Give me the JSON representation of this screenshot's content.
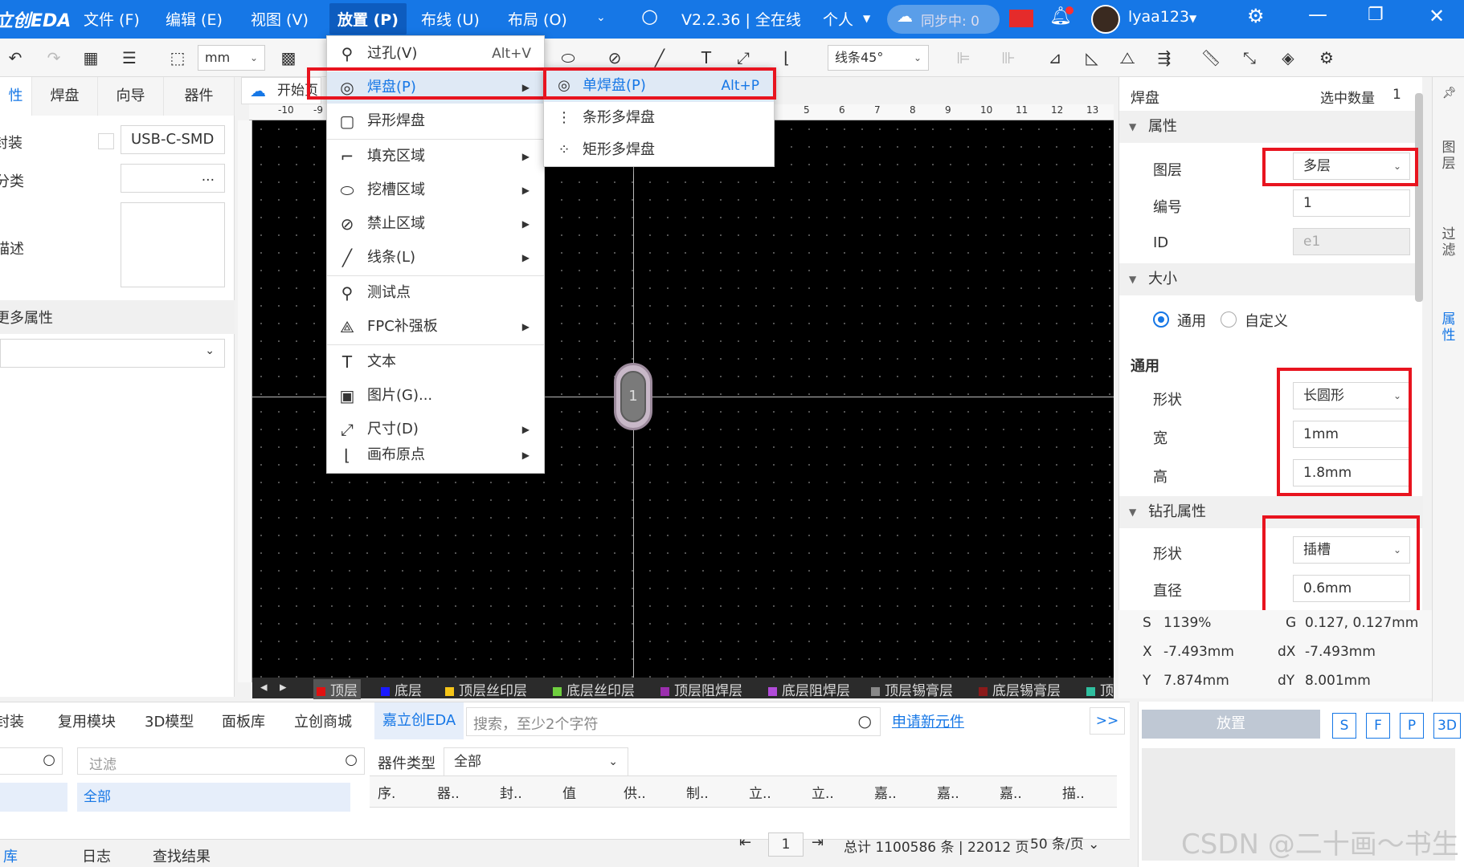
{
  "titlebar": {
    "logo": "立创EDA",
    "menus": [
      "文件 (F)",
      "编辑 (E)",
      "视图 (V)",
      "放置 (P)",
      "布线 (U)",
      "布局 (O)"
    ],
    "version": "V2.2.36 | 全在线",
    "mode": "个人",
    "sync": "同步中: 0",
    "username": "lyaa123"
  },
  "toolbar": {
    "unit": "mm",
    "line_mode": "线条45°"
  },
  "left_panel": {
    "tabs": [
      "性",
      "焊盘",
      "向导",
      "器件"
    ],
    "rows": {
      "footprint_label": "封装",
      "footprint_value": "USB-C-SMD",
      "category_label": "分类",
      "category_value": "...",
      "desc_label": "描述",
      "more_props": "更多属性"
    }
  },
  "canvas": {
    "tab_label": "开始页",
    "pad_number": "1",
    "ruler_top_ticks": [
      "-10",
      "-9",
      "5",
      "6",
      "7",
      "8",
      "9",
      "10",
      "11",
      "12",
      "13"
    ],
    "layers": [
      {
        "name": "顶层",
        "color": "#e11111"
      },
      {
        "name": "底层",
        "color": "#1a1aff"
      },
      {
        "name": "顶层丝印层",
        "color": "#f5c518"
      },
      {
        "name": "底层丝印层",
        "color": "#6fcf3f"
      },
      {
        "name": "顶层阻焊层",
        "color": "#9b2fae"
      },
      {
        "name": "底层阻焊层",
        "color": "#b14bd8"
      },
      {
        "name": "顶层锡膏层",
        "color": "#888888"
      },
      {
        "name": "底层锡膏层",
        "color": "#8b1a1a"
      },
      {
        "name": "顶",
        "color": "#2fbf9f"
      }
    ]
  },
  "place_menu": {
    "items": [
      {
        "label": "过孔(V)",
        "icon": "via-icon",
        "glyph": "⚲",
        "shortcut": "Alt+V",
        "submenu": false
      },
      {
        "label": "焊盘(P)",
        "icon": "pad-icon",
        "glyph": "◎",
        "shortcut": "",
        "submenu": true
      },
      {
        "label": "异形焊盘",
        "icon": "custom-pad-icon",
        "glyph": "▢",
        "shortcut": "",
        "submenu": false
      },
      {
        "label": "填充区域",
        "icon": "fill-region-icon",
        "glyph": "⌐",
        "shortcut": "",
        "submenu": true
      },
      {
        "label": "挖槽区域",
        "icon": "slot-region-icon",
        "glyph": "⬭",
        "shortcut": "",
        "submenu": true
      },
      {
        "label": "禁止区域",
        "icon": "keepout-icon",
        "glyph": "⊘",
        "shortcut": "",
        "submenu": true
      },
      {
        "label": "线条(L)",
        "icon": "line-icon",
        "glyph": "╱",
        "shortcut": "",
        "submenu": true
      },
      {
        "label": "测试点",
        "icon": "test-point-icon",
        "glyph": "⚲",
        "shortcut": "",
        "submenu": false
      },
      {
        "label": "FPC补强板",
        "icon": "fpc-stiffener-icon",
        "glyph": "⟁",
        "shortcut": "",
        "submenu": true
      },
      {
        "label": "文本",
        "icon": "text-icon",
        "glyph": "T",
        "shortcut": "",
        "submenu": false
      },
      {
        "label": "图片(G)...",
        "icon": "image-icon",
        "glyph": "▣",
        "shortcut": "",
        "submenu": false
      },
      {
        "label": "尺寸(D)",
        "icon": "dimension-icon",
        "glyph": "⤢",
        "shortcut": "",
        "submenu": true
      },
      {
        "label": "画布原点",
        "icon": "canvas-origin-icon",
        "glyph": "⌊",
        "shortcut": "",
        "submenu": true
      }
    ]
  },
  "pad_submenu": {
    "items": [
      {
        "label": "单焊盘(P)",
        "icon": "single-pad-icon",
        "glyph": "◎",
        "shortcut": "Alt+P"
      },
      {
        "label": "条形多焊盘",
        "icon": "strip-pads-icon",
        "glyph": "⋮",
        "shortcut": ""
      },
      {
        "label": "矩形多焊盘",
        "icon": "matrix-pads-icon",
        "glyph": "⁘",
        "shortcut": ""
      }
    ]
  },
  "right_panel": {
    "title": "焊盘",
    "selected_label": "选中数量",
    "selected_count": "1",
    "sec_props": "属性",
    "layer_label": "图层",
    "layer_value": "多层",
    "number_label": "编号",
    "number_value": "1",
    "id_label": "ID",
    "id_value": "e1",
    "sec_size": "大小",
    "radio_common": "通用",
    "radio_custom": "自定义",
    "common_heading": "通用",
    "shape_label": "形状",
    "shape_value": "长圆形",
    "width_label": "宽",
    "width_value": "1mm",
    "height_label": "高",
    "height_value": "1.8mm",
    "sec_drill": "钻孔属性",
    "drill_shape_label": "形状",
    "drill_shape_value": "插槽",
    "diameter_label": "直径",
    "diameter_value": "0.6mm",
    "side_tabs": [
      "图层",
      "过滤",
      "属性"
    ]
  },
  "coords": {
    "s_label": "S",
    "s_value": "1139%",
    "g_label": "G",
    "g_value": "0.127, 0.127mm",
    "x_label": "X",
    "x_value": "-7.493mm",
    "dx_label": "dX",
    "dx_value": "-7.493mm",
    "y_label": "Y",
    "y_value": "7.874mm",
    "dy_label": "dY",
    "dy_value": "8.001mm"
  },
  "bottom": {
    "tabs": [
      "封装",
      "复用模块",
      "3D模型",
      "面板库",
      "立创商城",
      "嘉立创EDA"
    ],
    "search_placeholder": "搜索，至少2个字符",
    "apply_link": "申请新元件",
    "more": ">>",
    "filter_placeholder": "过滤",
    "all_label": "全部",
    "type_label": "器件类型",
    "type_value": "全部",
    "columns": [
      "序.",
      "器..",
      "封..",
      "值",
      "供..",
      "制..",
      "立..",
      "立..",
      "嘉..",
      "嘉..",
      "嘉..",
      "描.."
    ],
    "footer_tabs": [
      "库",
      "日志",
      "查找结果"
    ],
    "page": "1",
    "total": "总计 1100586 条 | 22012 页",
    "per_page": "50 条/页",
    "place_btn": "放置",
    "view_btns": [
      "S",
      "F",
      "P",
      "3D"
    ]
  },
  "watermark": "CSDN @二十画～书生",
  "colors": {
    "accent": "#1677e6",
    "highlight_red": "#e8141f"
  }
}
